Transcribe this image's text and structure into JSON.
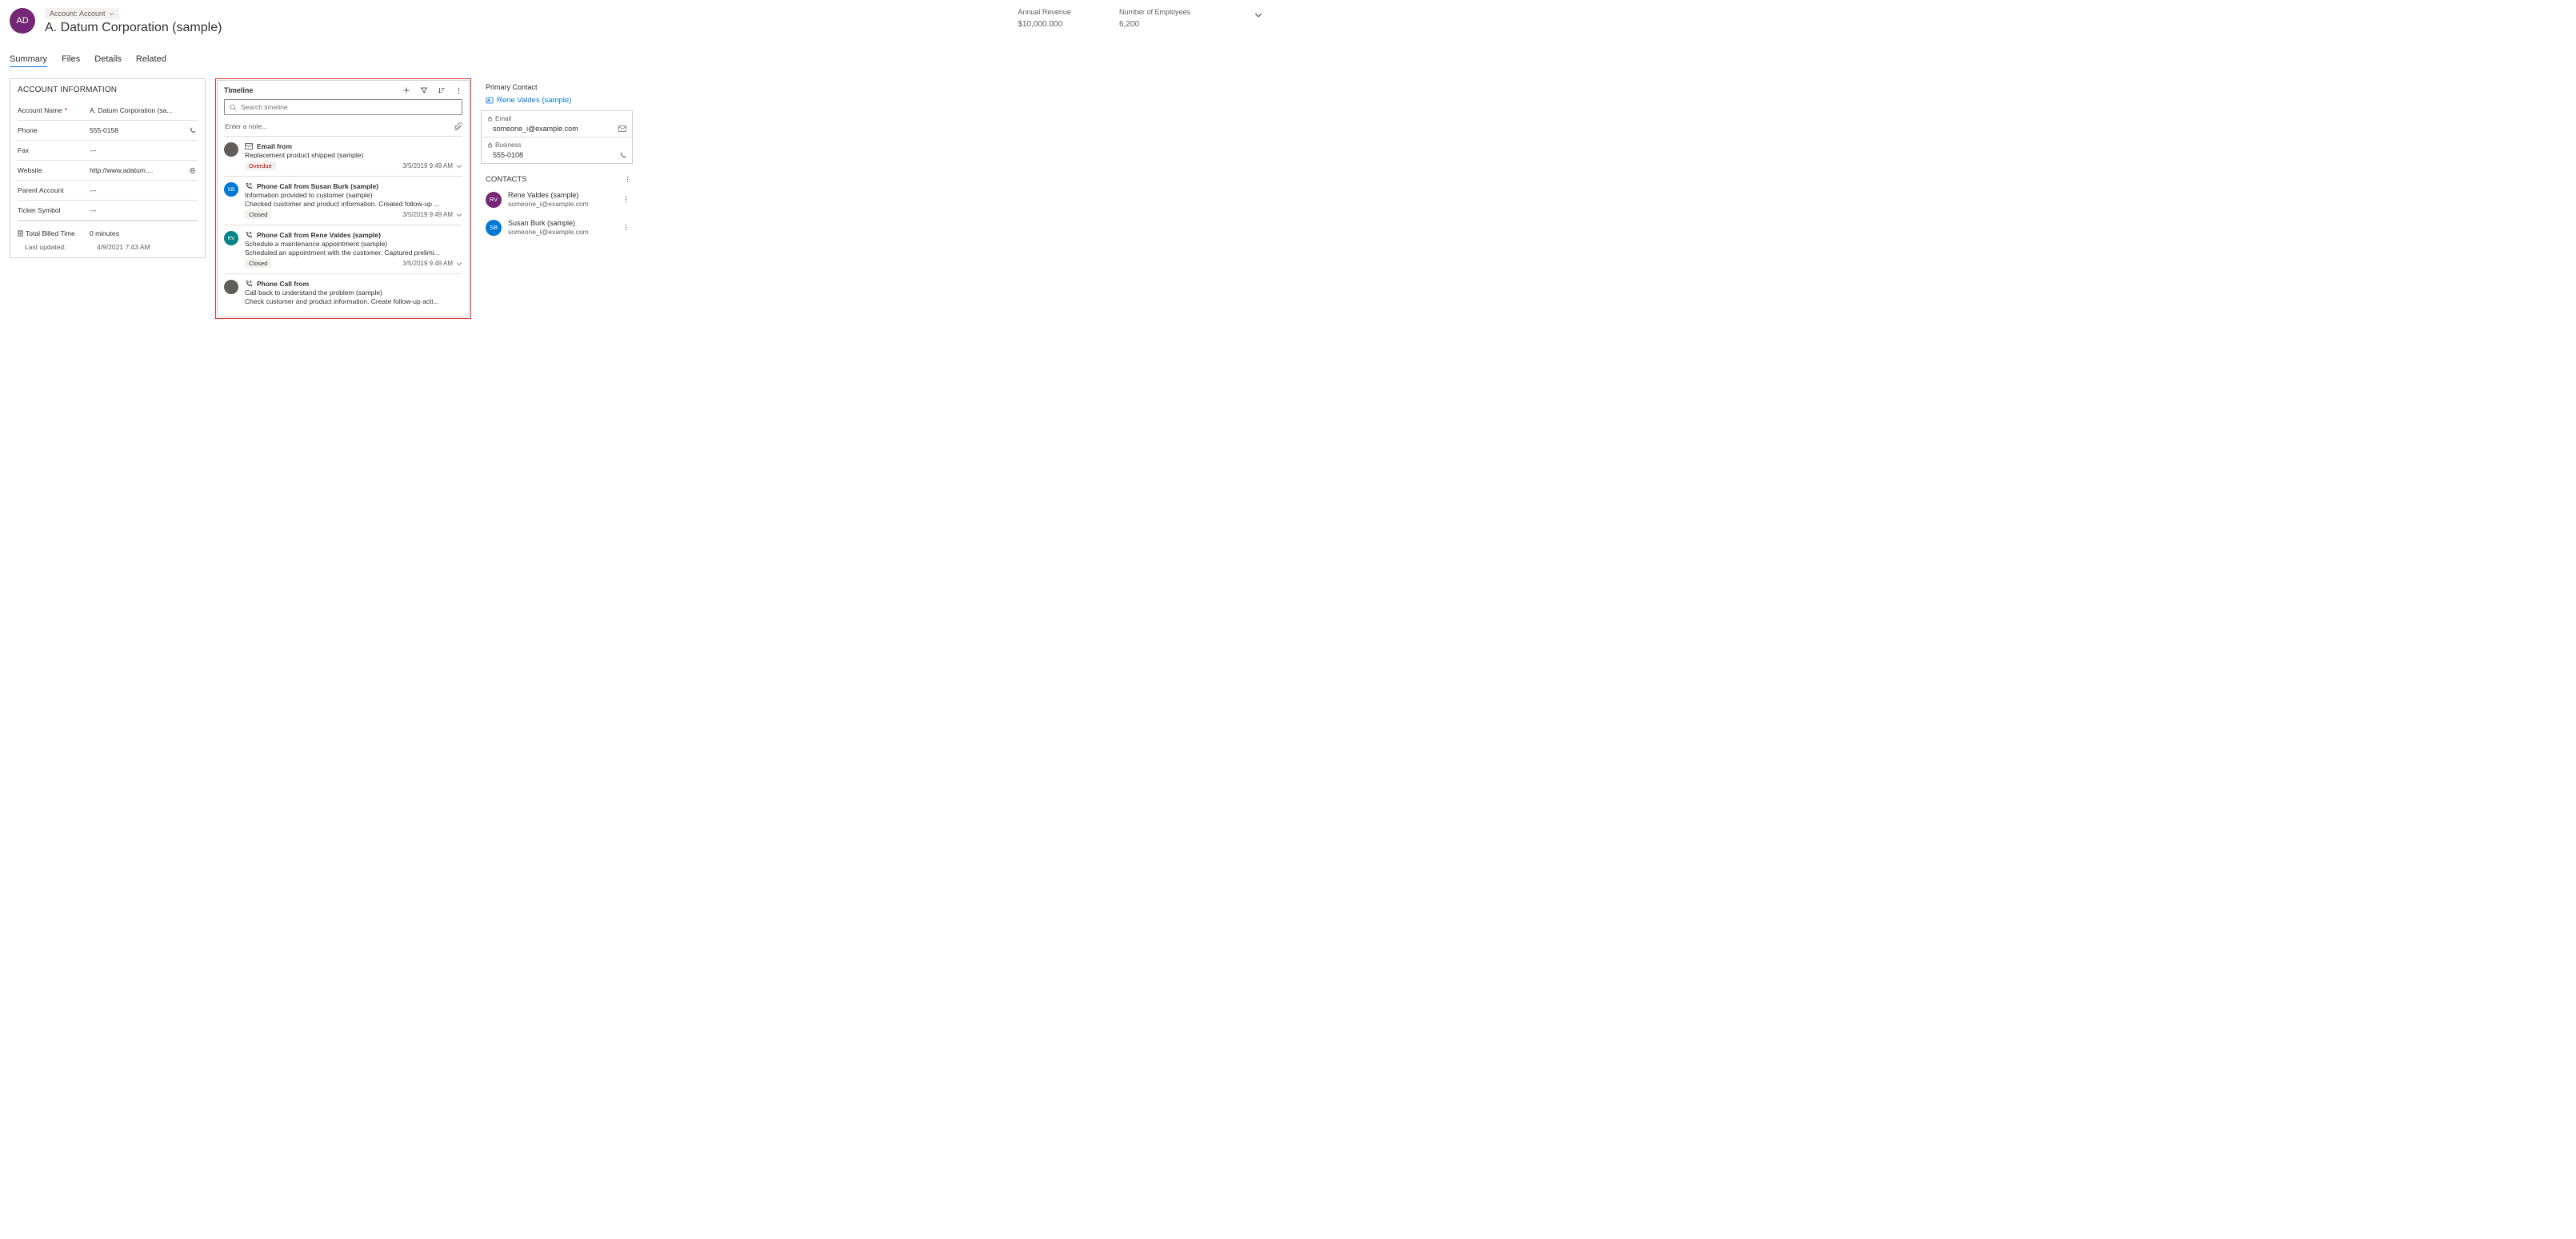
{
  "header": {
    "avatar_initials": "AD",
    "entity_label": "Account: Account",
    "title": "A. Datum Corporation (sample)",
    "stats": [
      {
        "label": "Annual Revenue",
        "value": "$10,000.000"
      },
      {
        "label": "Number of Employees",
        "value": "6,200"
      }
    ]
  },
  "tabs": [
    "Summary",
    "Files",
    "Details",
    "Related"
  ],
  "account_info": {
    "section_title": "ACCOUNT INFORMATION",
    "fields": {
      "account_name": {
        "label": "Account Name",
        "value": "A. Datum Corporation (sa...",
        "required": true
      },
      "phone": {
        "label": "Phone",
        "value": "555-0158"
      },
      "fax": {
        "label": "Fax",
        "value": "---"
      },
      "website": {
        "label": "Website",
        "value": "http://www.adatum...."
      },
      "parent_account": {
        "label": "Parent Account",
        "value": "---"
      },
      "ticker": {
        "label": "Ticker Symbol",
        "value": "---"
      },
      "billed": {
        "label": "Total Billed Time",
        "value": "0 minutes"
      },
      "last_updated": {
        "label": "Last updated:",
        "value": "4/9/2021 7:43 AM"
      }
    }
  },
  "timeline": {
    "title": "Timeline",
    "search_placeholder": "Search timeline",
    "note_placeholder": "Enter a note...",
    "items": [
      {
        "avatar": "",
        "avatar_class": "",
        "icon": "email",
        "title": "Email from",
        "subject": "Replacement product shipped (sample)",
        "desc": "",
        "badge": "Overdue",
        "badge_class": "overdue",
        "date": "3/5/2019 9:49 AM"
      },
      {
        "avatar": "SB",
        "avatar_class": "avatar-sb",
        "icon": "phone",
        "title": "Phone Call from Susan Burk (sample)",
        "subject": "Information provided to customer (sample)",
        "desc": "Checked customer and product information. Created follow-up ...",
        "badge": "Closed",
        "badge_class": "",
        "date": "3/5/2019 9:49 AM"
      },
      {
        "avatar": "RV",
        "avatar_class": "avatar-rv-teal",
        "icon": "phone",
        "title": "Phone Call from Rene Valdes (sample)",
        "subject": "Schedule a maintenance appointment (sample)",
        "desc": "Scheduled an appointment with the customer. Captured prelimi...",
        "badge": "Closed",
        "badge_class": "",
        "date": "3/5/2019 9:49 AM"
      },
      {
        "avatar": "",
        "avatar_class": "",
        "icon": "phone",
        "title": "Phone Call from",
        "subject": "Call back to understand the problem (sample)",
        "desc": "Check customer and product information. Create follow-up acti...",
        "badge": "",
        "badge_class": "",
        "date": ""
      }
    ]
  },
  "primary_contact": {
    "section_label": "Primary Contact",
    "name": "Rene Valdes (sample)",
    "email": {
      "label": "Email",
      "value": "someone_i@example.com"
    },
    "business": {
      "label": "Business",
      "value": "555-0108"
    }
  },
  "contacts": {
    "title": "CONTACTS",
    "items": [
      {
        "initials": "RV",
        "avatar_class": "avatar-rv-purple",
        "name": "Rene Valdes (sample)",
        "email": "someone_i@example.com"
      },
      {
        "initials": "SB",
        "avatar_class": "avatar-sb",
        "name": "Susan Burk (sample)",
        "email": "someone_l@example.com"
      }
    ]
  }
}
